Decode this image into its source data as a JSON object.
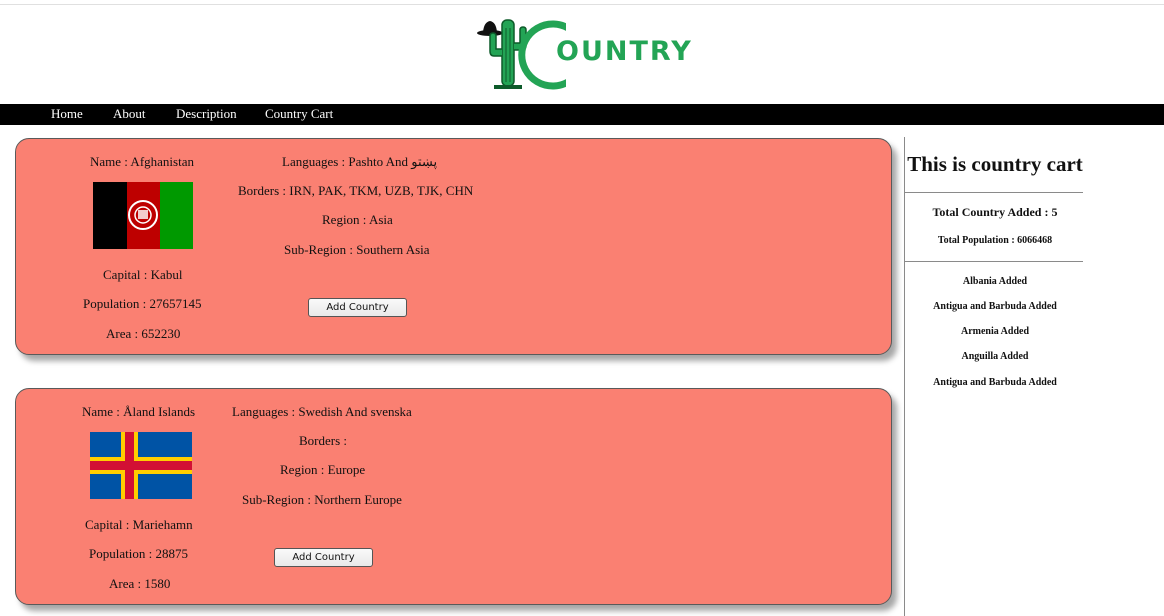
{
  "brand": {
    "logo_text": "OUNTRY",
    "accent_color": "#23a455"
  },
  "nav": {
    "items": [
      "Home",
      "About",
      "Description",
      "Country Cart"
    ]
  },
  "countries": [
    {
      "name": "Name : Afghanistan",
      "capital": "Capital : Kabul",
      "population": "Population : 27657145",
      "area": "Area : 652230",
      "languages": "Languages : Pashto And پښتو",
      "borders": "Borders : IRN, PAK, TKM, UZB, TJK, CHN",
      "region": "Region : Asia",
      "subregion": "Sub-Region : Southern Asia",
      "button": "Add Country",
      "flag_icon": "afghanistan-flag-icon"
    },
    {
      "name": "Name : Åland Islands",
      "capital": "Capital : Mariehamn",
      "population": "Population : 28875",
      "area": "Area : 1580",
      "languages": "Languages : Swedish And svenska",
      "borders": "Borders :",
      "region": "Region : Europe",
      "subregion": "Sub-Region : Northern Europe",
      "button": "Add Country",
      "flag_icon": "aland-islands-flag-icon"
    }
  ],
  "cart": {
    "title": "This is country cart",
    "total_added": "Total Country Added : 5",
    "total_population": "Total Population : 6066468",
    "items": [
      "Albania Added",
      "Antigua and Barbuda Added",
      "Armenia Added",
      "Anguilla Added",
      "Antigua and Barbuda Added"
    ]
  },
  "colors": {
    "card_bg": "#fa8072",
    "nav_bg": "#000000"
  }
}
